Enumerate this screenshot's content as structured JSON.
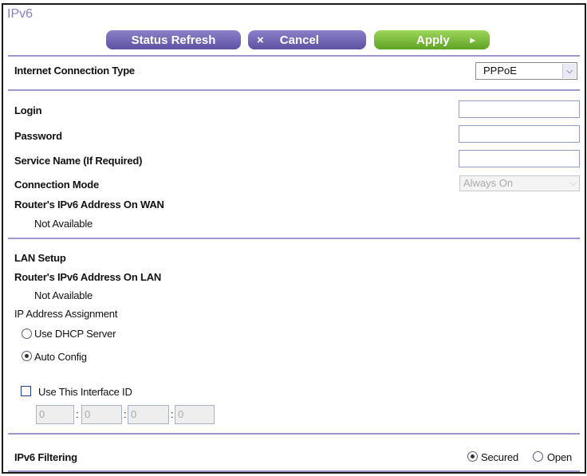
{
  "page": {
    "title": "IPv6"
  },
  "toolbar": {
    "refresh_label": "Status Refresh",
    "cancel_label": "Cancel",
    "apply_label": "Apply",
    "cancel_glyph": "×",
    "apply_glyph": "▸"
  },
  "connection": {
    "label": "Internet Connection Type",
    "selected": "PPPoE"
  },
  "pppoe": {
    "login_label": "Login",
    "password_label": "Password",
    "service_label": "Service Name (If Required)",
    "mode_label": "Connection Mode",
    "mode_value": "Always On",
    "wan_label": "Router's IPv6 Address On WAN",
    "wan_value": "Not Available"
  },
  "lan": {
    "heading": "LAN Setup",
    "addr_label": "Router's IPv6 Address On LAN",
    "addr_value": "Not Available",
    "assign_label": "IP Address Assignment",
    "dhcp_label": "Use DHCP Server",
    "auto_label": "Auto Config",
    "interface_label": "Use This Interface ID",
    "interface_id": [
      "0",
      "0",
      "0",
      "0"
    ],
    "sep": ":"
  },
  "filtering": {
    "label": "IPv6 Filtering",
    "secured_label": "Secured",
    "open_label": "Open"
  },
  "colors": {
    "accent": "#8a7fc8",
    "rule": "#9d97d2",
    "button_purple": "#6a5fb0",
    "button_green": "#78bb3a"
  },
  "icons": {
    "select_arrow": "chevron-down-icon",
    "cancel": "close-icon",
    "apply": "play-icon"
  }
}
